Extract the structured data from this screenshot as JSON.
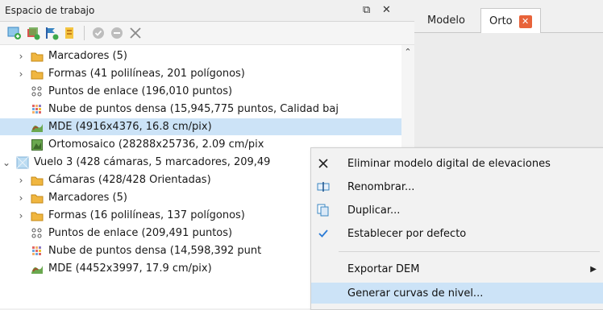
{
  "workspace": {
    "title": "Espacio de trabajo",
    "float_icon": "⧉",
    "close_icon": "✕"
  },
  "toolbar": {
    "items": [
      "add-chunk-icon",
      "add-photos-icon",
      "add-markers-icon",
      "import-icon",
      "enable-icon",
      "disable-icon",
      "remove-icon"
    ]
  },
  "tree": {
    "rows": [
      {
        "label": "Marcadores (5)",
        "icon": "folder"
      },
      {
        "label": "Formas (41 polilíneas, 201 polígonos)",
        "icon": "folder"
      },
      {
        "label": "Puntos de enlace (196,010 puntos)",
        "icon": "tie-points"
      },
      {
        "label": "Nube de puntos densa (15,945,775 puntos, Calidad baj",
        "icon": "dense-cloud"
      },
      {
        "label": "MDE (4916x4376, 16.8 cm/pix)",
        "icon": "dem"
      },
      {
        "label": "Ortomosaico (28288x25736, 2.09 cm/pix",
        "icon": "ortho"
      },
      {
        "label": "Vuelo 3 (428 cámaras, 5 marcadores, 209,49",
        "icon": "chunk"
      },
      {
        "label": "Cámaras (428/428 Orientadas)",
        "icon": "folder"
      },
      {
        "label": "Marcadores (5)",
        "icon": "folder"
      },
      {
        "label": "Formas (16 polilíneas, 137 polígonos)",
        "icon": "folder"
      },
      {
        "label": "Puntos de enlace (209,491 puntos)",
        "icon": "tie-points"
      },
      {
        "label": "Nube de puntos densa (14,598,392 punt",
        "icon": "dense-cloud"
      },
      {
        "label": "MDE (4452x3997, 17.9 cm/pix)",
        "icon": "dem"
      }
    ]
  },
  "tabs": {
    "modelo": "Modelo",
    "orto": "Orto"
  },
  "context_menu": {
    "delete": "Eliminar modelo digital de elevaciones",
    "rename": "Renombrar...",
    "duplicate": "Duplicar...",
    "set_default": "Establecer por defecto",
    "export": "Exportar DEM",
    "contours": "Generar curvas de nivel..."
  },
  "colors": {
    "selection": "#cce3f7",
    "folder": "#f0b640",
    "accent_close": "#e8633a",
    "check": "#2b7bd6"
  }
}
